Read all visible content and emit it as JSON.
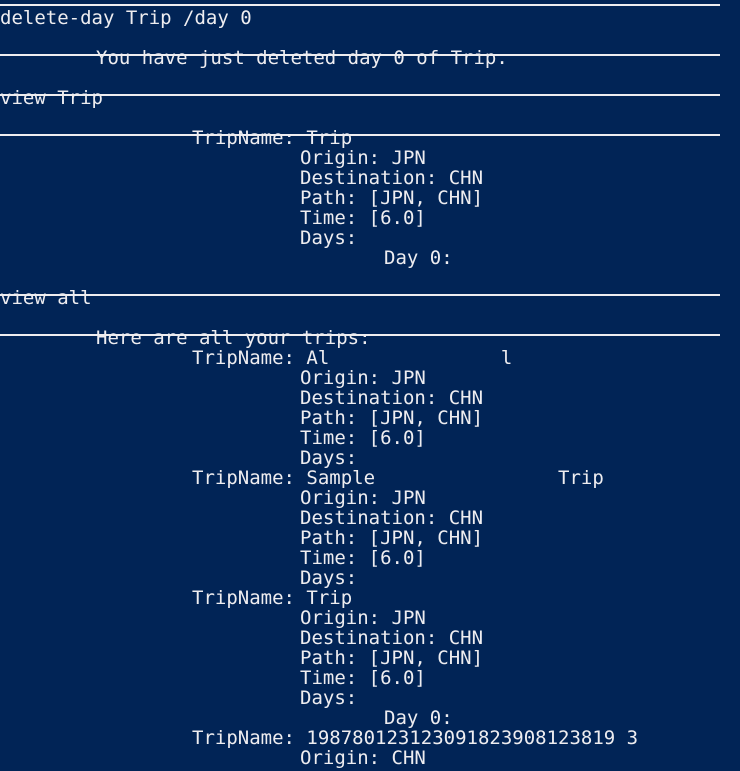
{
  "terminal": {
    "lines": [
      {
        "kind": "sep"
      },
      {
        "kind": "text",
        "indent": 0,
        "text": "delete-day Trip /day 0"
      },
      {
        "kind": "sep"
      },
      {
        "kind": "text",
        "indent": 8,
        "text": "You have just deleted day 0 of Trip."
      },
      {
        "kind": "sep"
      },
      {
        "kind": "text",
        "indent": 0,
        "text": "view Trip"
      },
      {
        "kind": "sep"
      },
      {
        "kind": "text",
        "indent": 16,
        "text": "TripName: Trip"
      },
      {
        "kind": "text",
        "indent": 25,
        "text": "Origin: JPN"
      },
      {
        "kind": "text",
        "indent": 25,
        "text": "Destination: CHN"
      },
      {
        "kind": "text",
        "indent": 25,
        "text": "Path: [JPN, CHN]"
      },
      {
        "kind": "text",
        "indent": 25,
        "text": "Time: [6.0]"
      },
      {
        "kind": "text",
        "indent": 25,
        "text": "Days:"
      },
      {
        "kind": "text",
        "indent": 32,
        "text": "Day 0:"
      },
      {
        "kind": "sep"
      },
      {
        "kind": "text",
        "indent": 0,
        "text": "view all"
      },
      {
        "kind": "sep"
      },
      {
        "kind": "text",
        "indent": 8,
        "text": "Here are all your trips:"
      },
      {
        "kind": "text",
        "indent": 16,
        "text": "TripName: Al               l"
      },
      {
        "kind": "text",
        "indent": 25,
        "text": "Origin: JPN"
      },
      {
        "kind": "text",
        "indent": 25,
        "text": "Destination: CHN"
      },
      {
        "kind": "text",
        "indent": 25,
        "text": "Path: [JPN, CHN]"
      },
      {
        "kind": "text",
        "indent": 25,
        "text": "Time: [6.0]"
      },
      {
        "kind": "text",
        "indent": 25,
        "text": "Days:"
      },
      {
        "kind": "text",
        "indent": 16,
        "text": "TripName: Sample                Trip"
      },
      {
        "kind": "text",
        "indent": 25,
        "text": "Origin: JPN"
      },
      {
        "kind": "text",
        "indent": 25,
        "text": "Destination: CHN"
      },
      {
        "kind": "text",
        "indent": 25,
        "text": "Path: [JPN, CHN]"
      },
      {
        "kind": "text",
        "indent": 25,
        "text": "Time: [6.0]"
      },
      {
        "kind": "text",
        "indent": 25,
        "text": "Days:"
      },
      {
        "kind": "text",
        "indent": 16,
        "text": "TripName: Trip"
      },
      {
        "kind": "text",
        "indent": 25,
        "text": "Origin: JPN"
      },
      {
        "kind": "text",
        "indent": 25,
        "text": "Destination: CHN"
      },
      {
        "kind": "text",
        "indent": 25,
        "text": "Path: [JPN, CHN]"
      },
      {
        "kind": "text",
        "indent": 25,
        "text": "Time: [6.0]"
      },
      {
        "kind": "text",
        "indent": 25,
        "text": "Days:"
      },
      {
        "kind": "text",
        "indent": 32,
        "text": "Day 0:"
      },
      {
        "kind": "text",
        "indent": 16,
        "text": "TripName: 198780123123091823908123819 3"
      },
      {
        "kind": "text",
        "indent": 25,
        "text": "Origin: CHN"
      }
    ]
  },
  "colors": {
    "background": "#012456",
    "foreground": "#eeedf0"
  }
}
